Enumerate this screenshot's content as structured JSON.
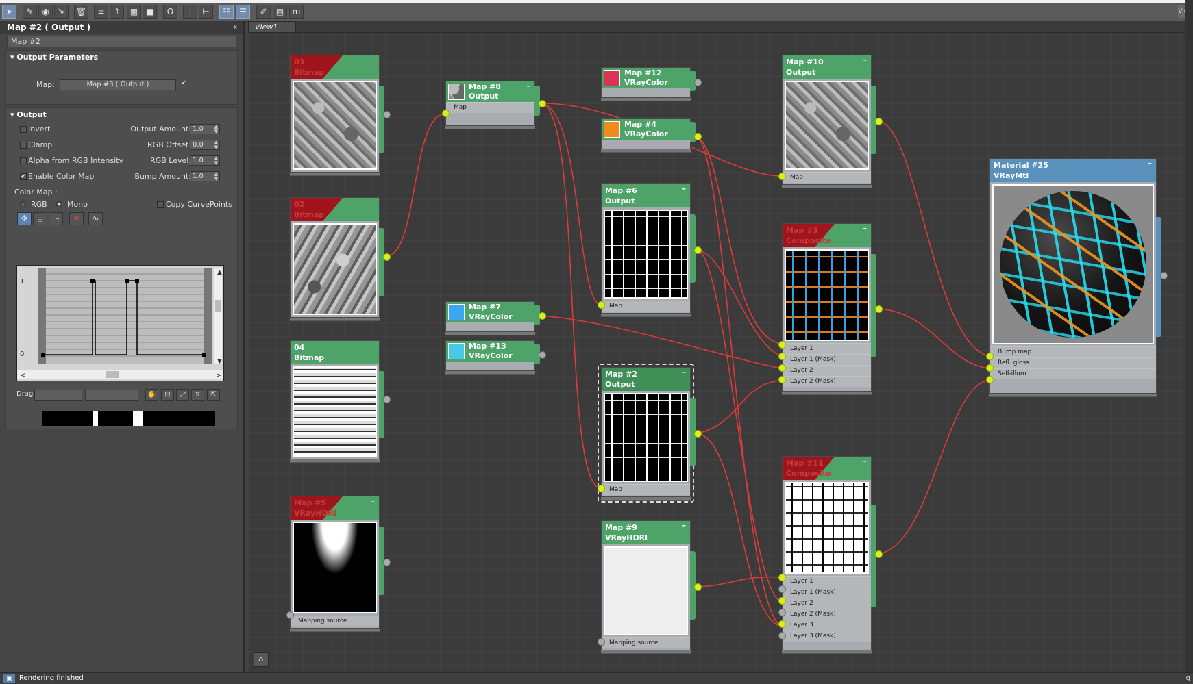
{
  "toolbar": {
    "icons": [
      "select-arrow-icon",
      "pencil-icon",
      "pick-material-icon",
      "assign-icon",
      "delete-icon",
      "layout-icon",
      "move-children-icon",
      "show-background-icon",
      "show-map-icon",
      "show-map-in-viewport-icon",
      "o-button",
      "layout-all-icon",
      "layout-children-icon",
      "view-parameters-icon",
      "view-nodes-icon",
      "pick-icon",
      "navigator-icon",
      "m-button"
    ]
  },
  "panel": {
    "title": "Map #2  ( Output )",
    "close": "x",
    "name_value": "Map #2",
    "output_params": {
      "heading": "Output Parameters",
      "map_label": "Map:",
      "map_value": "Map #8  ( Output )",
      "map_checkmark": "✔"
    },
    "output": {
      "heading": "Output",
      "invert": "Invert",
      "clamp": "Clamp",
      "alpha_rgb": "Alpha from RGB Intensity",
      "enable_color_map": "Enable Color Map",
      "output_amount_label": "Output Amount:",
      "output_amount": "1.0",
      "rgb_offset_label": "RGB Offset:",
      "rgb_offset": "0.0",
      "rgb_level_label": "RGB Level:",
      "rgb_level": "1.0",
      "bump_amount_label": "Bump Amount:",
      "bump_amount": "1.0",
      "color_map_label": "Color Map :",
      "rgb": "RGB",
      "mono": "Mono",
      "copy_curve": "Copy CurvePoints",
      "y1": "1",
      "y0": "0",
      "drag_label": "Drag"
    }
  },
  "view": {
    "tab": "View1",
    "corner_right": "View"
  },
  "status": {
    "text": "Rendering finished",
    "right": "g"
  },
  "nodes": {
    "n03": {
      "t1": "03",
      "t2": "Bitmap"
    },
    "n02": {
      "t1": "02",
      "t2": "Bitmap"
    },
    "n04": {
      "t1": "04",
      "t2": "Bitmap"
    },
    "n5": {
      "t1": "Map #5",
      "t2": "VRayHDRI",
      "slot1": "Mapping source"
    },
    "n8": {
      "t1": "Map #8",
      "t2": "Output",
      "slot1": "Map"
    },
    "n7": {
      "t1": "Map #7",
      "t2": "VRayColor"
    },
    "n13": {
      "t1": "Map #13",
      "t2": "VRayColor"
    },
    "n12": {
      "t1": "Map #12",
      "t2": "VRayColor"
    },
    "n4": {
      "t1": "Map #4",
      "t2": "VRayColor"
    },
    "n6": {
      "t1": "Map #6",
      "t2": "Output",
      "slot1": "Map"
    },
    "n2": {
      "t1": "Map #2",
      "t2": "Output",
      "slot1": "Map"
    },
    "n9": {
      "t1": "Map #9",
      "t2": "VRayHDRI",
      "slot1": "Mapping source"
    },
    "n10": {
      "t1": "Map #10",
      "t2": "Output",
      "slot1": "Map"
    },
    "n3": {
      "t1": "Map #3",
      "t2": "Composite",
      "slot1": "Layer 1",
      "slot2": "Layer 1 (Mask)",
      "slot3": "Layer 2",
      "slot4": "Layer 2 (Mask)"
    },
    "n11": {
      "t1": "Map #11",
      "t2": "Composite",
      "slot1": "Layer 1",
      "slot2": "Layer 1 (Mask)",
      "slot3": "Layer 2",
      "slot4": "Layer 2 (Mask)",
      "slot5": "Layer 3",
      "slot6": "Layer 3 (Mask)"
    },
    "n25": {
      "t1": "Material #25",
      "t2": "VRayMtl",
      "slot1": "Bump map",
      "slot2": "Refl. gloss.",
      "slot3": "Self-illum"
    }
  },
  "colors": {
    "node_green": "#4da368",
    "node_red": "#a0141c",
    "node_blue": "#5a90bc",
    "wire": "#e03a3a",
    "socket_on": "#d9f020",
    "map12": "#d8345a",
    "map4": "#f08a1e",
    "map7": "#3aa8ef",
    "map13": "#4ac8e8"
  }
}
